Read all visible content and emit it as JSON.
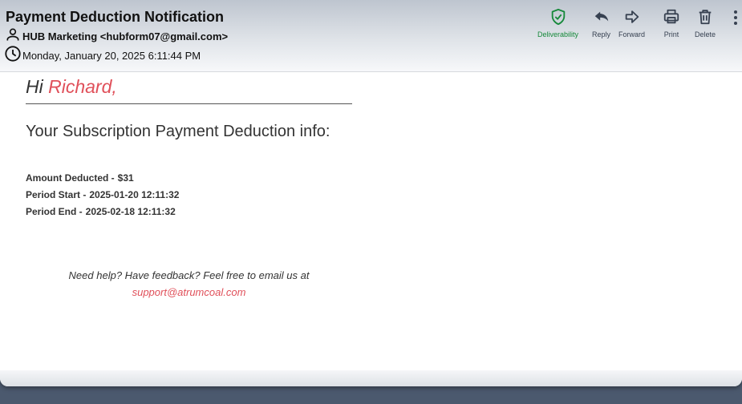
{
  "email": {
    "subject": "Payment Deduction Notification",
    "sender": "HUB Marketing <hubform07@gmail.com>",
    "date": "Monday, January 20, 2025 6:11:44 PM"
  },
  "toolbar": {
    "deliverability_label": "Deliverability",
    "reply_label": "Reply",
    "forward_label": "Forward",
    "print_label": "Print",
    "delete_label": "Delete"
  },
  "body": {
    "greeting_prefix": "Hi",
    "greeting_name": "Richard,",
    "info_title": "Your Subscription Payment Deduction info:",
    "details": [
      {
        "label": "Amount Deducted -",
        "value": "$31"
      },
      {
        "label": "Period Start -",
        "value": "2025-01-20 12:11:32"
      },
      {
        "label": "Period End -",
        "value": "2025-02-18 12:11:32"
      }
    ],
    "help_text": "Need help? Have feedback? Feel free to email us at",
    "support_email": "support@atrumcoal.com"
  },
  "icons": {
    "deliverability": "shield-check-icon",
    "reply": "reply-arrow-icon",
    "forward": "forward-arrow-icon",
    "print": "printer-icon",
    "delete": "trash-icon",
    "more": "more-vertical-icon",
    "sender": "person-icon",
    "date": "clock-icon"
  },
  "colors": {
    "accent": "#e0505a",
    "deliverability": "#16893a",
    "background": "#4b596e"
  }
}
